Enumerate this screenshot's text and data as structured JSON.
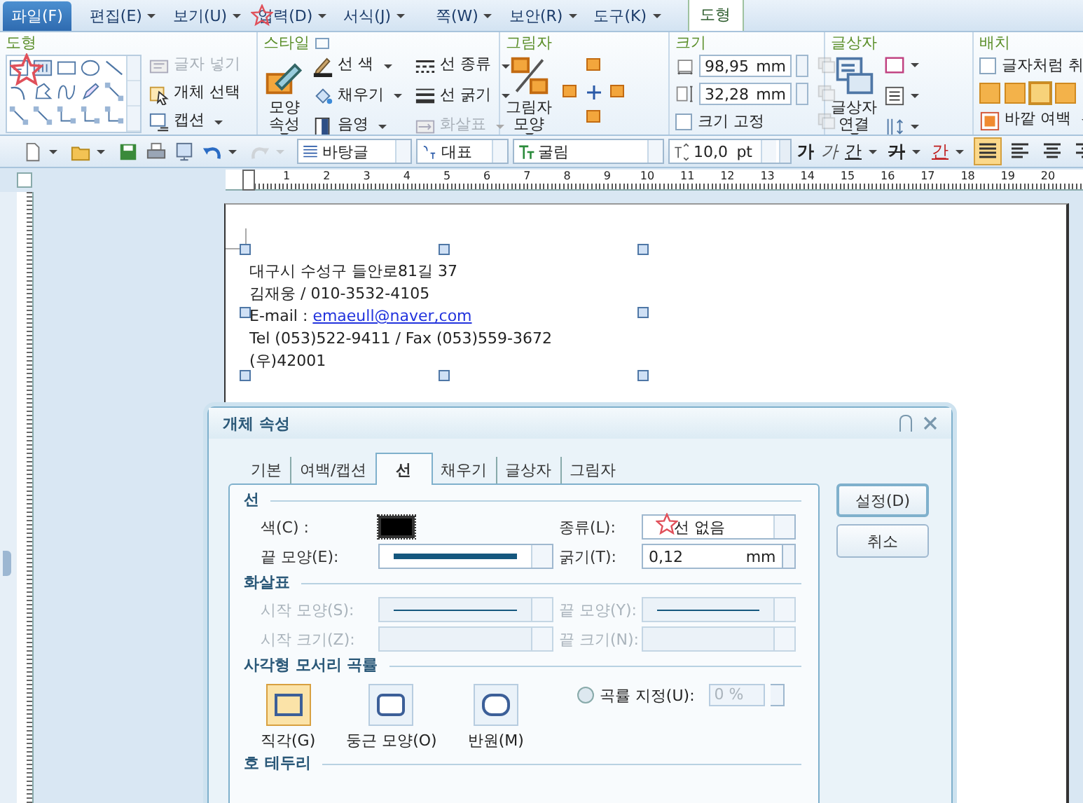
{
  "menu": [
    {
      "label": "파일(F)",
      "kind": "file",
      "dropdown": false
    },
    {
      "label": "편집(E)",
      "kind": "menu",
      "dropdown": true
    },
    {
      "label": "보기(U)",
      "kind": "menu",
      "dropdown": true
    },
    {
      "label": "입력(D)",
      "kind": "menu",
      "dropdown": true
    },
    {
      "label": "서식(J)",
      "kind": "menu",
      "dropdown": true
    },
    {
      "label": "쪽(W)",
      "kind": "menu",
      "dropdown": true
    },
    {
      "label": "보안(R)",
      "kind": "menu",
      "dropdown": true
    },
    {
      "label": "도구(K)",
      "kind": "menu",
      "dropdown": true
    },
    {
      "label": "도형",
      "kind": "tab",
      "dropdown": false
    }
  ],
  "ribbon": [
    {
      "title": "도형",
      "columns": [
        [
          {
            "kind": "gallery"
          }
        ],
        [
          {
            "kind": "small",
            "label": "글자 넣기",
            "disabled": true,
            "dropdown": false
          },
          {
            "kind": "small",
            "label": "개체 선택",
            "disabled": false,
            "dropdown": false
          },
          {
            "kind": "small",
            "label": "캡션",
            "disabled": false,
            "dropdown": true
          }
        ]
      ]
    },
    {
      "title": "스타일",
      "columns": [
        [
          {
            "kind": "big",
            "lines": [
              "모양",
              "속성"
            ],
            "disabled": false,
            "dropdown": true
          }
        ],
        [
          {
            "kind": "small",
            "label": "선 색",
            "disabled": false,
            "dropdown": true
          },
          {
            "kind": "small",
            "label": "채우기",
            "disabled": false,
            "dropdown": true
          },
          {
            "kind": "small",
            "label": "음영",
            "disabled": false,
            "dropdown": true
          }
        ],
        [
          {
            "kind": "small",
            "label": "선 종류",
            "disabled": false,
            "dropdown": true
          },
          {
            "kind": "small",
            "label": "선 굵기",
            "disabled": false,
            "dropdown": true
          },
          {
            "kind": "small",
            "label": "화살표",
            "disabled": true,
            "dropdown": true
          }
        ]
      ]
    },
    {
      "title": "그림자",
      "columns": [
        [
          {
            "kind": "big",
            "lines": [
              "그림자",
              "모양"
            ],
            "disabled": false,
            "dropdown": true
          }
        ],
        [
          {
            "kind": "nudge"
          }
        ]
      ]
    },
    {
      "title": "크기",
      "columns": [
        [
          {
            "kind": "spin",
            "value": "98,95",
            "unit": "mm"
          },
          {
            "kind": "spin",
            "value": "32,28",
            "unit": "mm"
          },
          {
            "kind": "check",
            "label": "크기 고정",
            "checked": false
          }
        ],
        [
          {
            "kind": "icon",
            "disabled": true,
            "dropdown": false
          },
          {
            "kind": "icon",
            "disabled": true,
            "dropdown": false
          },
          {
            "kind": "icon",
            "disabled": true,
            "dropdown": false
          }
        ]
      ]
    },
    {
      "title": "글상자",
      "columns": [
        [
          {
            "kind": "big",
            "lines": [
              "글상자",
              "연결"
            ],
            "disabled": false,
            "dropdown": true
          }
        ],
        [
          {
            "kind": "icon",
            "disabled": false,
            "dropdown": true
          },
          {
            "kind": "icon",
            "disabled": false,
            "dropdown": true
          },
          {
            "kind": "icon",
            "disabled": false,
            "dropdown": true
          }
        ]
      ]
    },
    {
      "title": "배치",
      "columns": [
        [
          {
            "kind": "check",
            "label": "글자처럼 취",
            "checked": false
          },
          {
            "kind": "wraprow",
            "options": [
              {
                "selected": false
              },
              {
                "selected": false
              },
              {
                "selected": true
              },
              {
                "selected": false
              }
            ]
          },
          {
            "kind": "small",
            "label": "바깥 여백",
            "disabled": false,
            "dropdown": true
          }
        ]
      ]
    }
  ],
  "toolbar": [
    {
      "kind": "icon",
      "dropdown": true,
      "disabled": false
    },
    {
      "kind": "icon",
      "dropdown": true,
      "disabled": false
    },
    {
      "kind": "icon",
      "dropdown": false,
      "disabled": false
    },
    {
      "kind": "icon",
      "dropdown": false,
      "disabled": false
    },
    {
      "kind": "icon",
      "dropdown": false,
      "disabled": false
    },
    {
      "kind": "icon",
      "dropdown": true,
      "disabled": false
    },
    {
      "kind": "icon",
      "dropdown": true,
      "disabled": true
    },
    {
      "kind": "select",
      "value": "바탕글"
    },
    {
      "kind": "select",
      "value": "대표"
    },
    {
      "kind": "select",
      "value": "굴림"
    },
    {
      "kind": "size",
      "value": "10,0",
      "unit": "pt"
    },
    {
      "kind": "format",
      "label": "가",
      "dropdown": false
    },
    {
      "kind": "format",
      "label": "가",
      "dropdown": false
    },
    {
      "kind": "format",
      "label": "간",
      "dropdown": true
    },
    {
      "kind": "format",
      "label": "가",
      "dropdown": true
    },
    {
      "kind": "format",
      "label": "간",
      "dropdown": true
    },
    {
      "kind": "align",
      "selected": true
    },
    {
      "kind": "align",
      "selected": false
    },
    {
      "kind": "align",
      "selected": false
    },
    {
      "kind": "align",
      "selected": false
    }
  ],
  "ruler": {
    "labels": [
      "1",
      "2",
      "3",
      "4",
      "5",
      "6",
      "7",
      "8",
      "9",
      "10",
      "11",
      "12",
      "13",
      "14",
      "15",
      "16",
      "17",
      "18",
      "19",
      "20"
    ]
  },
  "document": {
    "lines": [
      {
        "text": "대구시 수성구 들안로81길 37"
      },
      {
        "text": "김재웅 / 010-3532-4105"
      },
      {
        "text": "E-mail : ",
        "link": "emaeull@naver,com"
      },
      {
        "text": "Tel (053)522-9411 / Fax (053)559-3672"
      },
      {
        "text": "(우)42001"
      }
    ]
  },
  "dialog": {
    "title": "개체 속성",
    "tabs": [
      {
        "label": "기본",
        "selected": false
      },
      {
        "label": "여백/캡션",
        "selected": false
      },
      {
        "label": "선",
        "selected": true
      },
      {
        "label": "채우기",
        "selected": false
      },
      {
        "label": "글상자",
        "selected": false
      },
      {
        "label": "그림자",
        "selected": false
      }
    ],
    "buttons": [
      {
        "label": "설정(D)",
        "default": true
      },
      {
        "label": "취소",
        "default": false
      }
    ],
    "sections": [
      {
        "title": "선",
        "kind": "fields",
        "fields": [
          {
            "label": "색(C) :",
            "kind": "color",
            "color": "#000000",
            "disabled": false
          },
          {
            "label": "종류(L):",
            "kind": "select",
            "value": "선 없음",
            "disabled": false
          },
          {
            "label": "끝 모양(E):",
            "kind": "line",
            "disabled": false
          },
          {
            "label": "굵기(T):",
            "kind": "spin",
            "value": "0,12",
            "unit": "mm",
            "disabled": false
          }
        ]
      },
      {
        "title": "화살표",
        "kind": "fields",
        "fields": [
          {
            "label": "시작 모양(S):",
            "kind": "line",
            "disabled": true
          },
          {
            "label": "끝 모양(Y):",
            "kind": "line",
            "disabled": true
          },
          {
            "label": "시작 크기(Z):",
            "kind": "select",
            "disabled": true
          },
          {
            "label": "끝 크기(N):",
            "kind": "select",
            "disabled": true
          }
        ]
      },
      {
        "title": "사각형 모서리 곡률",
        "kind": "corners",
        "options": [
          {
            "label": "직각(G)",
            "selected": true
          },
          {
            "label": "둥근 모양(O)",
            "selected": false
          },
          {
            "label": "반원(M)",
            "selected": false
          }
        ],
        "radio": {
          "label": "곡률 지정(U):",
          "checked": false,
          "value": "0 %",
          "disabled": true
        }
      },
      {
        "title": "호 테두리",
        "kind": "header"
      }
    ]
  }
}
